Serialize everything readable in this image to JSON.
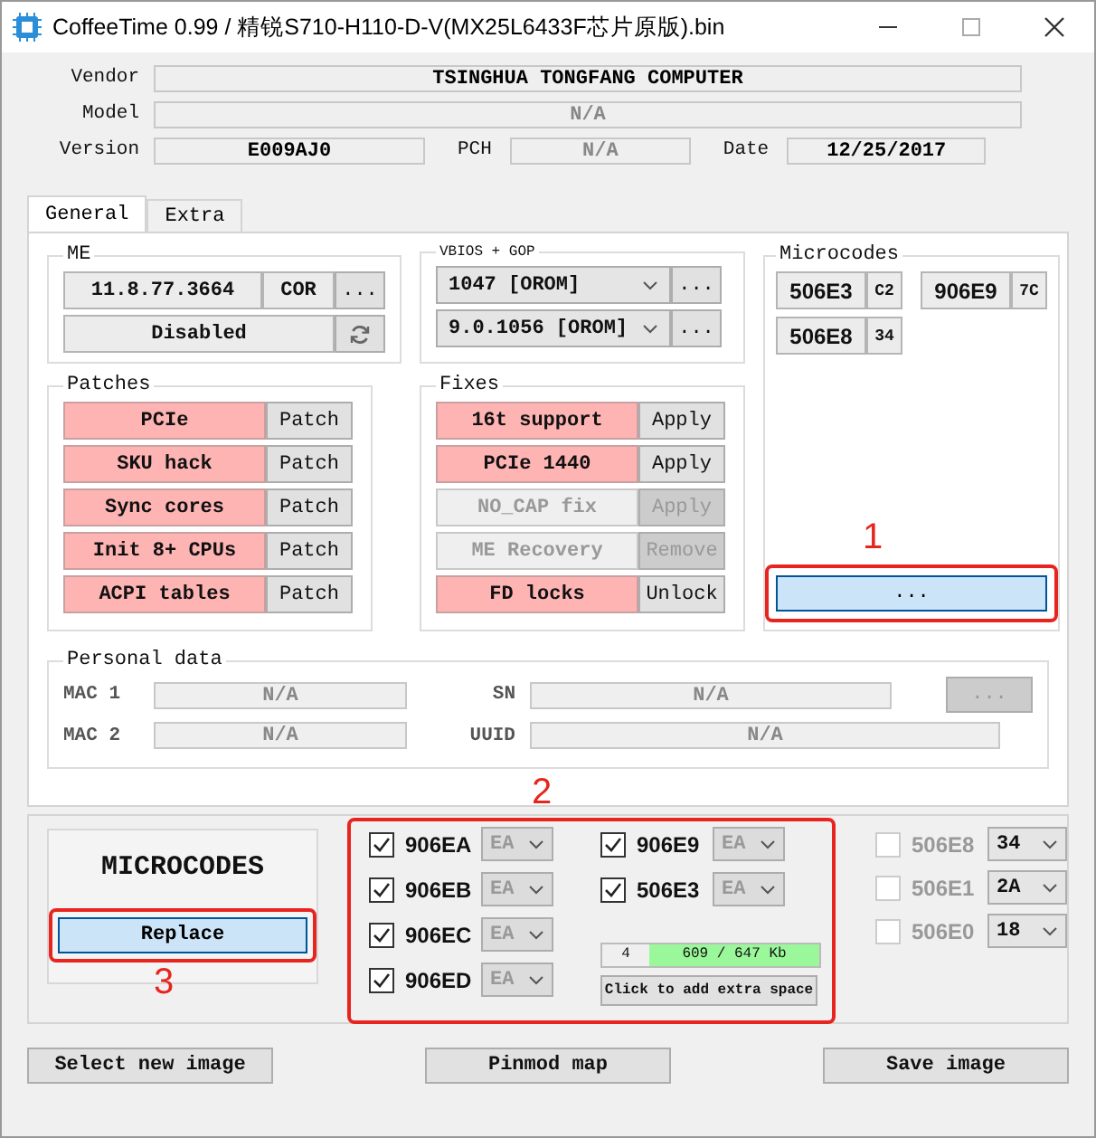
{
  "window": {
    "title": "CoffeeTime 0.99  /  精锐S710-H110-D-V(MX25L6433F芯片原版).bin"
  },
  "header": {
    "vendor": {
      "label": "Vendor",
      "value": "TSINGHUA TONGFANG COMPUTER",
      "disabled": false
    },
    "model": {
      "label": "Model",
      "value": "N/A",
      "disabled": true
    },
    "version": {
      "label": "Version",
      "value": "E009AJ0",
      "disabled": false
    },
    "pch": {
      "label": "PCH",
      "value": "N/A",
      "disabled": true
    },
    "date": {
      "label": "Date",
      "value": "12/25/2017",
      "disabled": false
    }
  },
  "tabs": [
    {
      "label": "General",
      "selected": true
    },
    {
      "label": "Extra",
      "selected": false
    }
  ],
  "me": {
    "title": "ME",
    "version": "11.8.77.3664",
    "sku": "COR",
    "more": "...",
    "state": "Disabled"
  },
  "vbios": {
    "title": "VBIOS + GOP",
    "vbios": "1047 [OROM]",
    "gop": "9.0.1056 [OROM]",
    "more": "..."
  },
  "microcodes": {
    "title": "Microcodes",
    "items": [
      {
        "cpuid": "506E3",
        "platform": "C2"
      },
      {
        "cpuid": "906E9",
        "platform": "7C"
      },
      {
        "cpuid": "506E8",
        "platform": "34"
      }
    ],
    "button": {
      "label": "...",
      "callout": "1"
    }
  },
  "patches": {
    "title": "Patches",
    "items": [
      {
        "label": "PCIe",
        "action": "Patch",
        "disabled": false
      },
      {
        "label": "SKU hack",
        "action": "Patch",
        "disabled": false
      },
      {
        "label": "Sync cores",
        "action": "Patch",
        "disabled": false
      },
      {
        "label": "Init 8+ CPUs",
        "action": "Patch",
        "disabled": false
      },
      {
        "label": "ACPI tables",
        "action": "Patch",
        "disabled": false
      }
    ]
  },
  "fixes": {
    "title": "Fixes",
    "items": [
      {
        "label": "16t support",
        "action": "Apply",
        "disabled": false
      },
      {
        "label": "PCIe 1440",
        "action": "Apply",
        "disabled": false
      },
      {
        "label": "NO_CAP fix",
        "action": "Apply",
        "disabled": true
      },
      {
        "label": "ME Recovery",
        "action": "Remove",
        "disabled": true
      },
      {
        "label": "FD locks",
        "action": "Unlock",
        "disabled": false
      }
    ]
  },
  "personal_data": {
    "title": "Personal data",
    "mac1": {
      "label": "MAC 1",
      "value": "N/A"
    },
    "mac2": {
      "label": "MAC 2",
      "value": "N/A"
    },
    "sn": {
      "label": "SN",
      "value": "N/A"
    },
    "uuid": {
      "label": "UUID",
      "value": "N/A"
    },
    "more": {
      "label": "...",
      "disabled": true
    }
  },
  "replace_panel": {
    "title": "MICROCODES",
    "button": "Replace",
    "callout": "3"
  },
  "selected_microcodes": {
    "callout": "2",
    "columns": [
      {
        "items": [
          {
            "cpuid": "906EA",
            "checked": true,
            "value": "EA"
          },
          {
            "cpuid": "906EB",
            "checked": true,
            "value": "EA"
          },
          {
            "cpuid": "906EC",
            "checked": true,
            "value": "EA"
          },
          {
            "cpuid": "906ED",
            "checked": true,
            "value": "EA"
          }
        ]
      },
      {
        "items": [
          {
            "cpuid": "906E9",
            "checked": true,
            "value": "EA"
          },
          {
            "cpuid": "506E3",
            "checked": true,
            "value": "EA"
          }
        ]
      }
    ],
    "count": "4",
    "size": "609 / 647 Kb",
    "extra_space": "Click to add extra space"
  },
  "other_microcodes": [
    {
      "cpuid": "506E8",
      "checked": false,
      "value": "34"
    },
    {
      "cpuid": "506E1",
      "checked": false,
      "value": "2A"
    },
    {
      "cpuid": "506E0",
      "checked": false,
      "value": "18"
    }
  ],
  "buttons": [
    "Select new image",
    "Pinmod map",
    "Save image"
  ]
}
